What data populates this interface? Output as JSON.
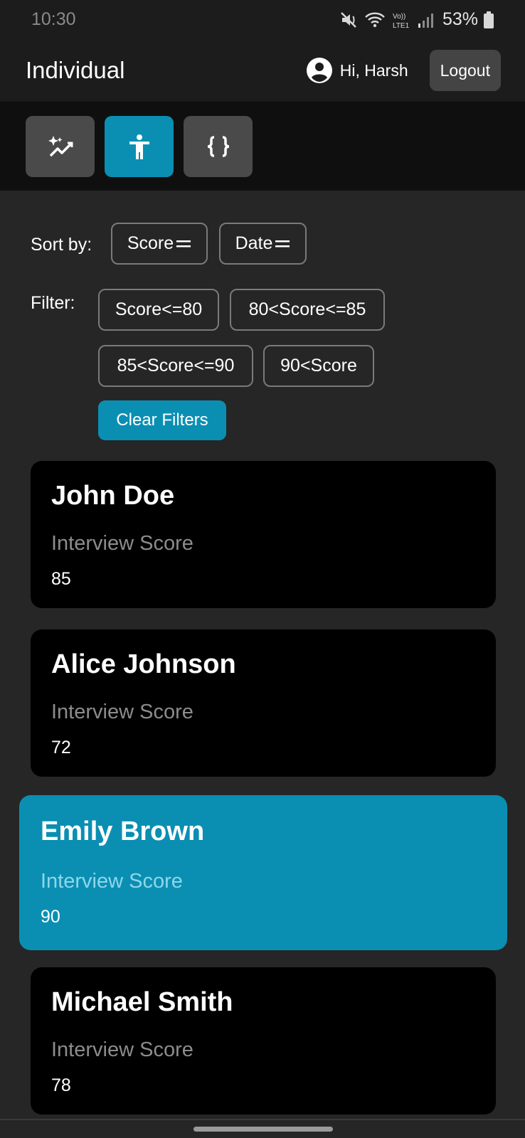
{
  "status_bar": {
    "time": "10:30",
    "network": "Vo)) LTE1",
    "battery": "53%"
  },
  "app_bar": {
    "title": "Individual",
    "greeting": "Hi, Harsh",
    "logout_label": "Logout"
  },
  "tabs": [
    {
      "icon": "sparkle-trend-icon",
      "active": false
    },
    {
      "icon": "person-icon",
      "active": true
    },
    {
      "icon": "code-braces-icon",
      "active": false
    }
  ],
  "sort": {
    "label": "Sort by:",
    "options": [
      "Score",
      "Date"
    ]
  },
  "filter": {
    "label": "Filter:",
    "options": [
      "Score<=80",
      "80<Score<=85",
      "85<Score<=90",
      "90<Score"
    ],
    "clear_label": "Clear Filters"
  },
  "candidates": [
    {
      "name": "John Doe",
      "label": "Interview Score",
      "score": "85",
      "selected": false
    },
    {
      "name": "Alice Johnson",
      "label": "Interview Score",
      "score": "72",
      "selected": false
    },
    {
      "name": "Emily Brown",
      "label": "Interview Score",
      "score": "90",
      "selected": true
    },
    {
      "name": "Michael Smith",
      "label": "Interview Score",
      "score": "78",
      "selected": false
    }
  ],
  "colors": {
    "accent": "#0a8fb3",
    "background": "#262626",
    "card": "#000000"
  }
}
